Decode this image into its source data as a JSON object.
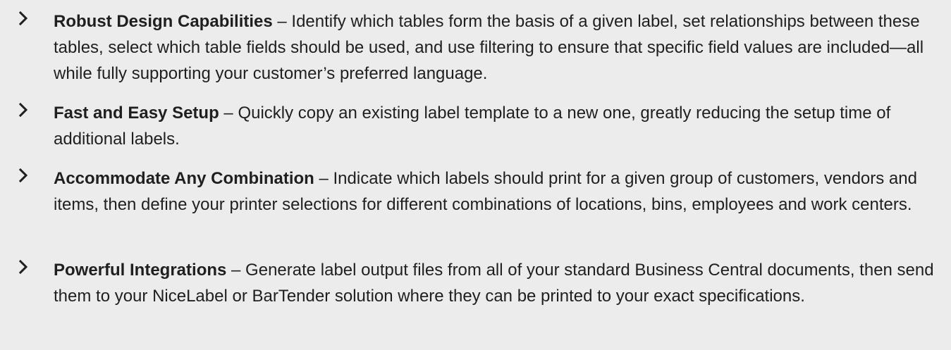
{
  "items": [
    {
      "icon": "chevron-right-icon",
      "title": "Robust Design Capabilities",
      "separator": " – ",
      "description": "Identify which tables form the basis of a given label, set relationships between these tables, select which table fields should be used, and use filtering to ensure that specific field values are included—all while fully supporting your customer’s preferred language."
    },
    {
      "icon": "chevron-right-icon",
      "title": "Fast and Easy Setup",
      "separator": " – ",
      "description": "Quickly copy an existing label template to a new one, greatly reducing the setup time of additional labels."
    },
    {
      "icon": "chevron-right-icon",
      "title": "Accommodate Any Combination",
      "separator": " – ",
      "description": "Indicate which labels should print for a given group of customers, vendors and items, then define your printer selections for different combinations of locations, bins, employees and work centers."
    },
    {
      "icon": "chevron-right-icon",
      "title": "Powerful Integrations",
      "separator": " – ",
      "description": "Generate label output files from all of your standard Business Central documents, then send them to your NiceLabel or BarTender solution where they can be printed to your exact specifications."
    }
  ],
  "colors": {
    "background": "#ececec",
    "text": "#1f1f1f"
  }
}
